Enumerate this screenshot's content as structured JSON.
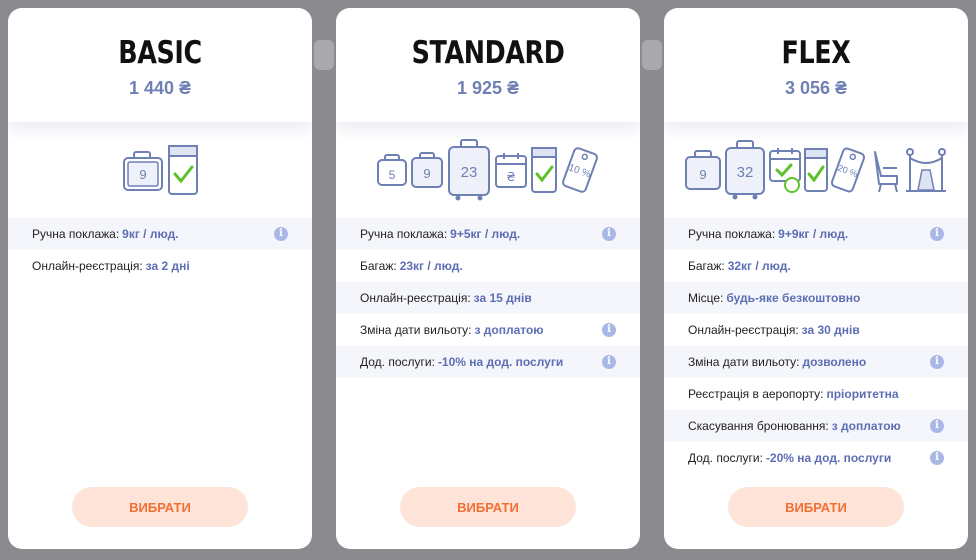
{
  "plans": [
    {
      "name": "BASIC",
      "price": "1 440 ₴",
      "features": [
        {
          "label": "Ручна поклажа:",
          "value": "9кг / люд.",
          "info": true
        },
        {
          "label": "Онлайн-реєстрація:",
          "value": "за 2 дні",
          "info": false
        }
      ],
      "icons": [
        "hand-bag-9-icon",
        "checkin-check-icon"
      ],
      "button": "ВИБРАТИ"
    },
    {
      "name": "STANDARD",
      "price": "1 925 ₴",
      "features": [
        {
          "label": "Ручна поклажа:",
          "value": "9+5кг / люд.",
          "info": true
        },
        {
          "label": "Багаж:",
          "value": "23кг / люд.",
          "info": false
        },
        {
          "label": "Онлайн-реєстрація:",
          "value": "за 15 днів",
          "info": false
        },
        {
          "label": "Зміна дати вильоту:",
          "value": "з доплатою",
          "info": true
        },
        {
          "label": "Дод. послуги:",
          "value": "-10% на дод. послуги",
          "info": true
        }
      ],
      "icon_labels": {
        "bag_small": "5",
        "bag_hand": "9",
        "suitcase": "23",
        "calendar": "₴",
        "discount": "10 %"
      },
      "button": "ВИБРАТИ"
    },
    {
      "name": "FLEX",
      "price": "3 056 ₴",
      "features": [
        {
          "label": "Ручна поклажа:",
          "value": "9+9кг / люд.",
          "info": true
        },
        {
          "label": "Багаж:",
          "value": "32кг / люд.",
          "info": false
        },
        {
          "label": "Місце:",
          "value": "будь-яке безкоштовно",
          "info": false
        },
        {
          "label": "Онлайн-реєстрація:",
          "value": "за 30 днів",
          "info": false
        },
        {
          "label": "Зміна дати вильоту:",
          "value": "дозволено",
          "info": true
        },
        {
          "label": "Реєстрація в аеропорту:",
          "value": "пріоритетна",
          "info": false
        },
        {
          "label": "Скасування бронювання:",
          "value": "з доплатою",
          "info": true
        },
        {
          "label": "Дод. послуги:",
          "value": "-20% на дод. послуги",
          "info": true
        }
      ],
      "icon_labels": {
        "bag_hand": "9",
        "suitcase": "32",
        "discount": "20 %"
      },
      "button": "ВИБРАТИ"
    }
  ],
  "info_glyph": "i",
  "colors": {
    "accent": "#6f80b5",
    "value": "#5d6eb3",
    "button_bg": "#fde3d8",
    "button_text": "#f36f32",
    "check": "#5fc02c",
    "info": "#a9b8e6"
  }
}
